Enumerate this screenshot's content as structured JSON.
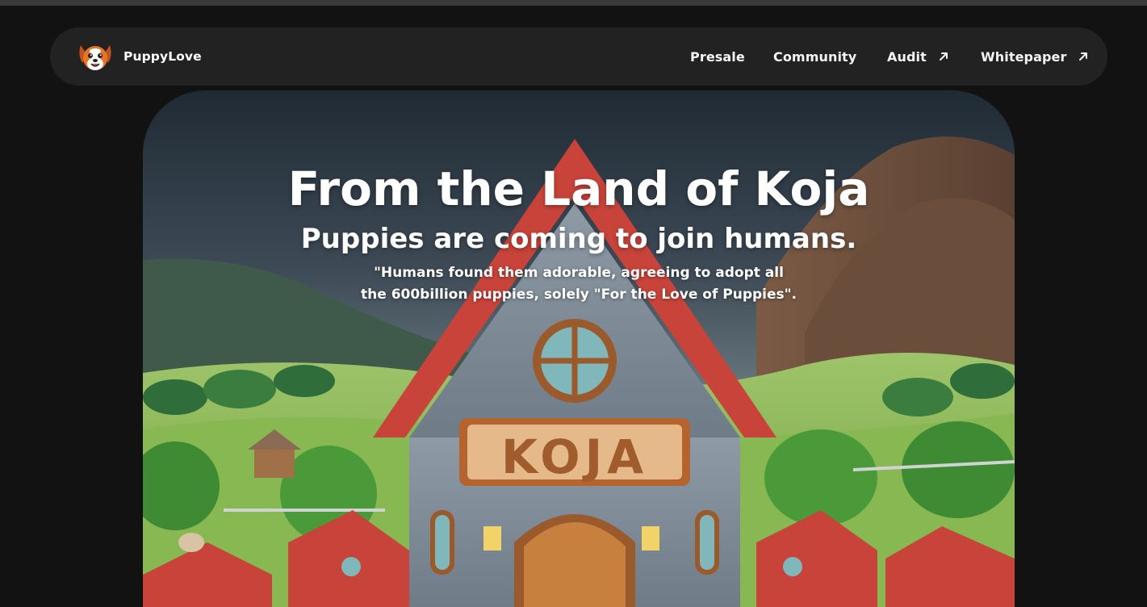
{
  "navbar": {
    "brand_name": "PuppyLove",
    "logo_icon": "puppy-face-icon",
    "items": [
      {
        "label": "Presale",
        "external": false
      },
      {
        "label": "Community",
        "external": false
      },
      {
        "label": "Audit",
        "external": true,
        "icon": "arrow-up-right-icon"
      },
      {
        "label": "Whitepaper",
        "external": true,
        "icon": "arrow-up-right-icon"
      }
    ]
  },
  "hero": {
    "title": "From the Land of Koja",
    "subtitle": "Puppies are coming to join humans.",
    "quote": "\"Humans found them adorable, agreeing to adopt all the 600billion puppies, solely \"For the Love of Puppies\".",
    "house_sign": "KOJA"
  },
  "colors": {
    "page_bg": "#121212",
    "navbar_bg": "#222222",
    "text": "#ffffff",
    "roof_red": "#c8443a",
    "sky": "#3f4a54"
  }
}
